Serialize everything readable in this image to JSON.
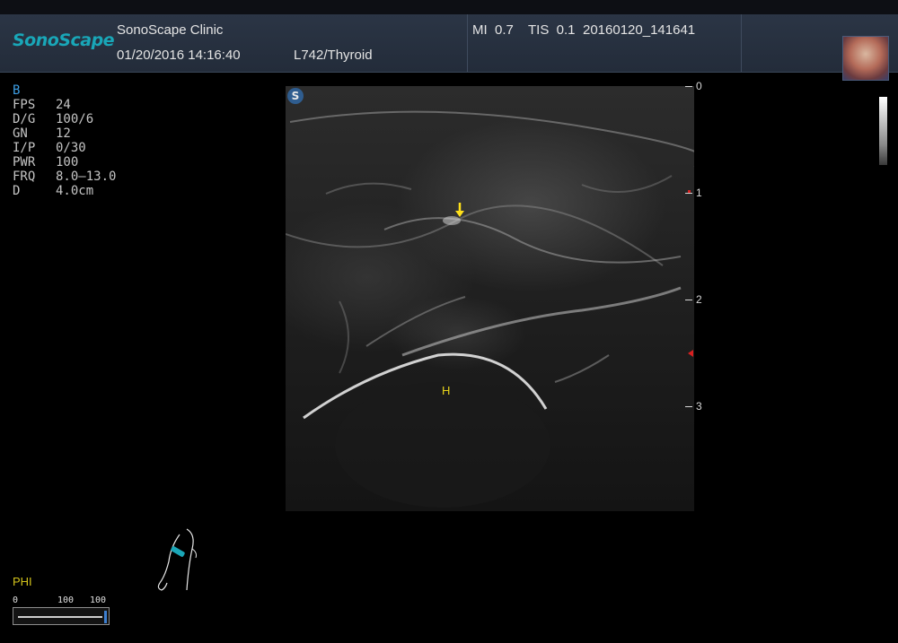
{
  "header": {
    "logo": "SonoScape",
    "clinic": "SonoScape Clinic",
    "datetime": "01/20/2016 14:16:40",
    "probe_preset": "L742/Thyroid",
    "mi": "MI  0.7",
    "tis": "TIS  0.1",
    "exam_id": "20160120_141641"
  },
  "params": {
    "mode": "B",
    "rows": [
      {
        "key": "FPS",
        "value": "24"
      },
      {
        "key": "D/G",
        "value": "100/6"
      },
      {
        "key": "GN",
        "value": "12"
      },
      {
        "key": "I/P",
        "value": "0/30"
      },
      {
        "key": "PWR",
        "value": "100"
      },
      {
        "key": "FRQ",
        "value": "8.0–13.0"
      },
      {
        "key": "D",
        "value": "4.0cm"
      }
    ]
  },
  "image": {
    "s_badge": "S",
    "annotation_h": "H"
  },
  "depth_scale": {
    "labels": [
      "0",
      "1",
      "2",
      "3"
    ]
  },
  "phi": {
    "label": "PHI",
    "left_value": "0",
    "mid_value": "100",
    "right_value": "100"
  },
  "colors": {
    "accent_teal": "#19a7b8",
    "mode_blue": "#3d9ee4",
    "annotation_yellow": "#e6d21a",
    "focus_red": "#d82020"
  }
}
